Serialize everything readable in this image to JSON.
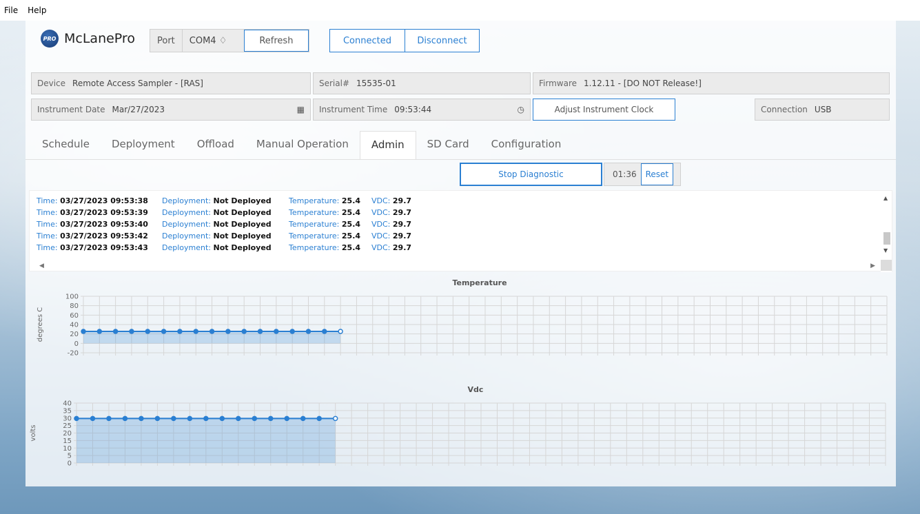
{
  "menubar": {
    "items": [
      "File",
      "Help"
    ]
  },
  "header": {
    "brand": "McLanePro",
    "brand_badge": "PRO",
    "port_label": "Port",
    "port_value": "COM4 ♢",
    "refresh_label": "Refresh",
    "connected_label": "Connected",
    "disconnect_label": "Disconnect"
  },
  "info": {
    "device_label": "Device",
    "device_value": "Remote Access Sampler - [RAS]",
    "serial_label": "Serial#",
    "serial_value": "15535-01",
    "firmware_label": "Firmware",
    "firmware_value": "1.12.11 - [DO NOT Release!]",
    "date_label": "Instrument Date",
    "date_value": "Mar/27/2023",
    "time_label": "Instrument Time",
    "time_value": "09:53:44",
    "adjust_clock_label": "Adjust Instrument Clock",
    "connection_label": "Connection",
    "connection_value": "USB"
  },
  "tabs": [
    "Schedule",
    "Deployment",
    "Offload",
    "Manual Operation",
    "Admin",
    "SD Card",
    "Configuration"
  ],
  "active_tab": "Admin",
  "diagnostic": {
    "stop_label": "Stop Diagnostic",
    "elapsed": "01:36",
    "reset_label": "Reset"
  },
  "log": {
    "time_key": "Time:",
    "deployment_key": "Deployment:",
    "temperature_key": "Temperature:",
    "vdc_key": "VDC:",
    "rows": [
      {
        "time": "03/27/2023 09:53:38",
        "deployment": "Not Deployed",
        "temperature": "25.4",
        "vdc": "29.7"
      },
      {
        "time": "03/27/2023 09:53:39",
        "deployment": "Not Deployed",
        "temperature": "25.4",
        "vdc": "29.7"
      },
      {
        "time": "03/27/2023 09:53:40",
        "deployment": "Not Deployed",
        "temperature": "25.4",
        "vdc": "29.7"
      },
      {
        "time": "03/27/2023 09:53:42",
        "deployment": "Not Deployed",
        "temperature": "25.4",
        "vdc": "29.7"
      },
      {
        "time": "03/27/2023 09:53:43",
        "deployment": "Not Deployed",
        "temperature": "25.4",
        "vdc": "29.7"
      }
    ]
  },
  "chart_data": [
    {
      "type": "area",
      "title": "Temperature",
      "ylabel": "degrees C",
      "ylim": [
        -20,
        100
      ],
      "yticks": [
        100,
        80,
        60,
        40,
        20,
        0,
        -20
      ],
      "x_slots": 50,
      "values": [
        25.4,
        25.4,
        25.4,
        25.4,
        25.4,
        25.4,
        25.4,
        25.4,
        25.4,
        25.4,
        25.4,
        25.4,
        25.4,
        25.4,
        25.4,
        25.4,
        25.4
      ],
      "color": "#2a7fd2"
    },
    {
      "type": "area",
      "title": "Vdc",
      "ylabel": "volts",
      "ylim": [
        0,
        40
      ],
      "yticks": [
        40,
        35,
        30,
        25,
        20,
        15,
        10,
        5,
        0
      ],
      "x_slots": 50,
      "values": [
        29.7,
        29.7,
        29.7,
        29.7,
        29.7,
        29.7,
        29.7,
        29.7,
        29.7,
        29.7,
        29.7,
        29.7,
        29.7,
        29.7,
        29.7,
        29.7,
        29.7
      ],
      "color": "#2a7fd2"
    }
  ]
}
